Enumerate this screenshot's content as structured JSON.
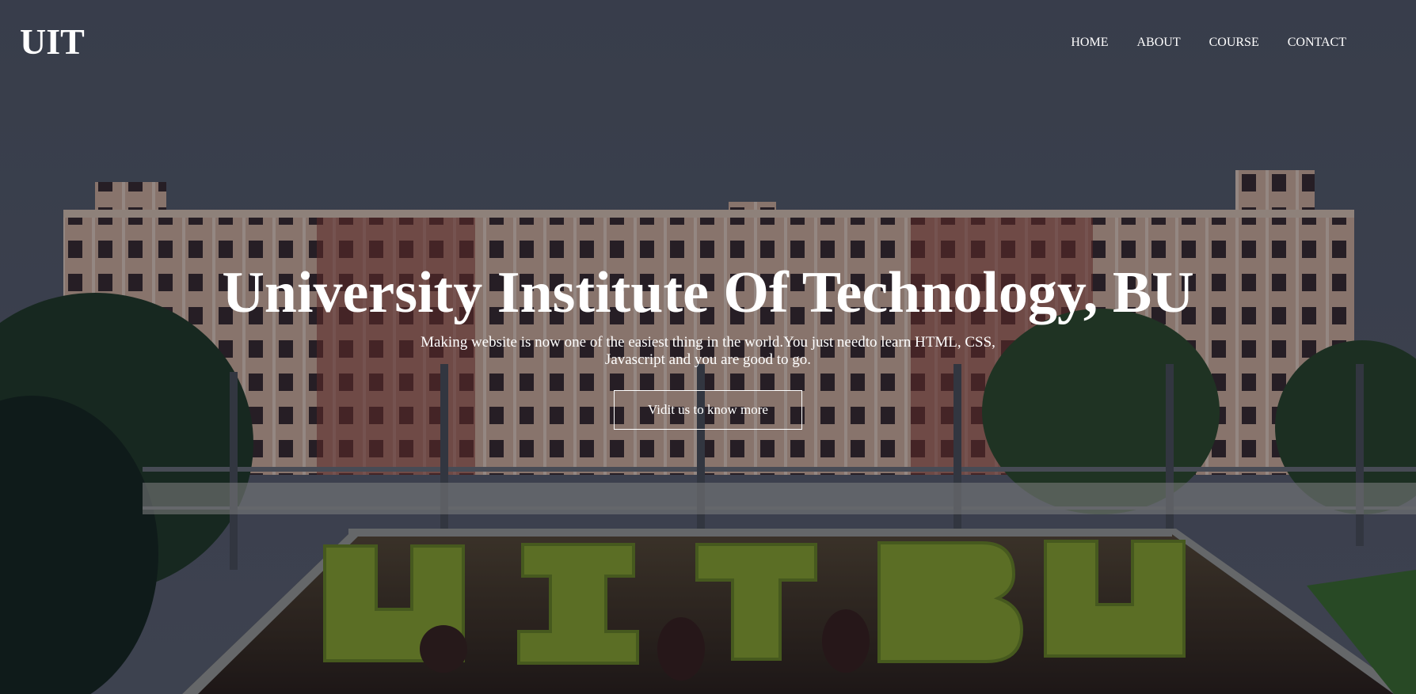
{
  "header": {
    "logo": "UIT",
    "nav": [
      "HOME",
      "ABOUT",
      "COURSE",
      "CONTACT"
    ]
  },
  "hero": {
    "title": "University Institute Of Technology, BU",
    "subtitle": "Making website is now one of the easiest thing in the world.You just needto learn HTML, CSS, Javascript and you are good to go.",
    "button_label": "Vidit us to know more",
    "background_letters": [
      "U",
      "I",
      "T",
      "B",
      "U"
    ]
  },
  "colors": {
    "sky": "#4b4f59",
    "building": "#c9a892",
    "accent_brick": "#9b3a2c",
    "foliage": "#2f4a2c",
    "hedge": "#8aa52a",
    "text": "#ffffff"
  }
}
